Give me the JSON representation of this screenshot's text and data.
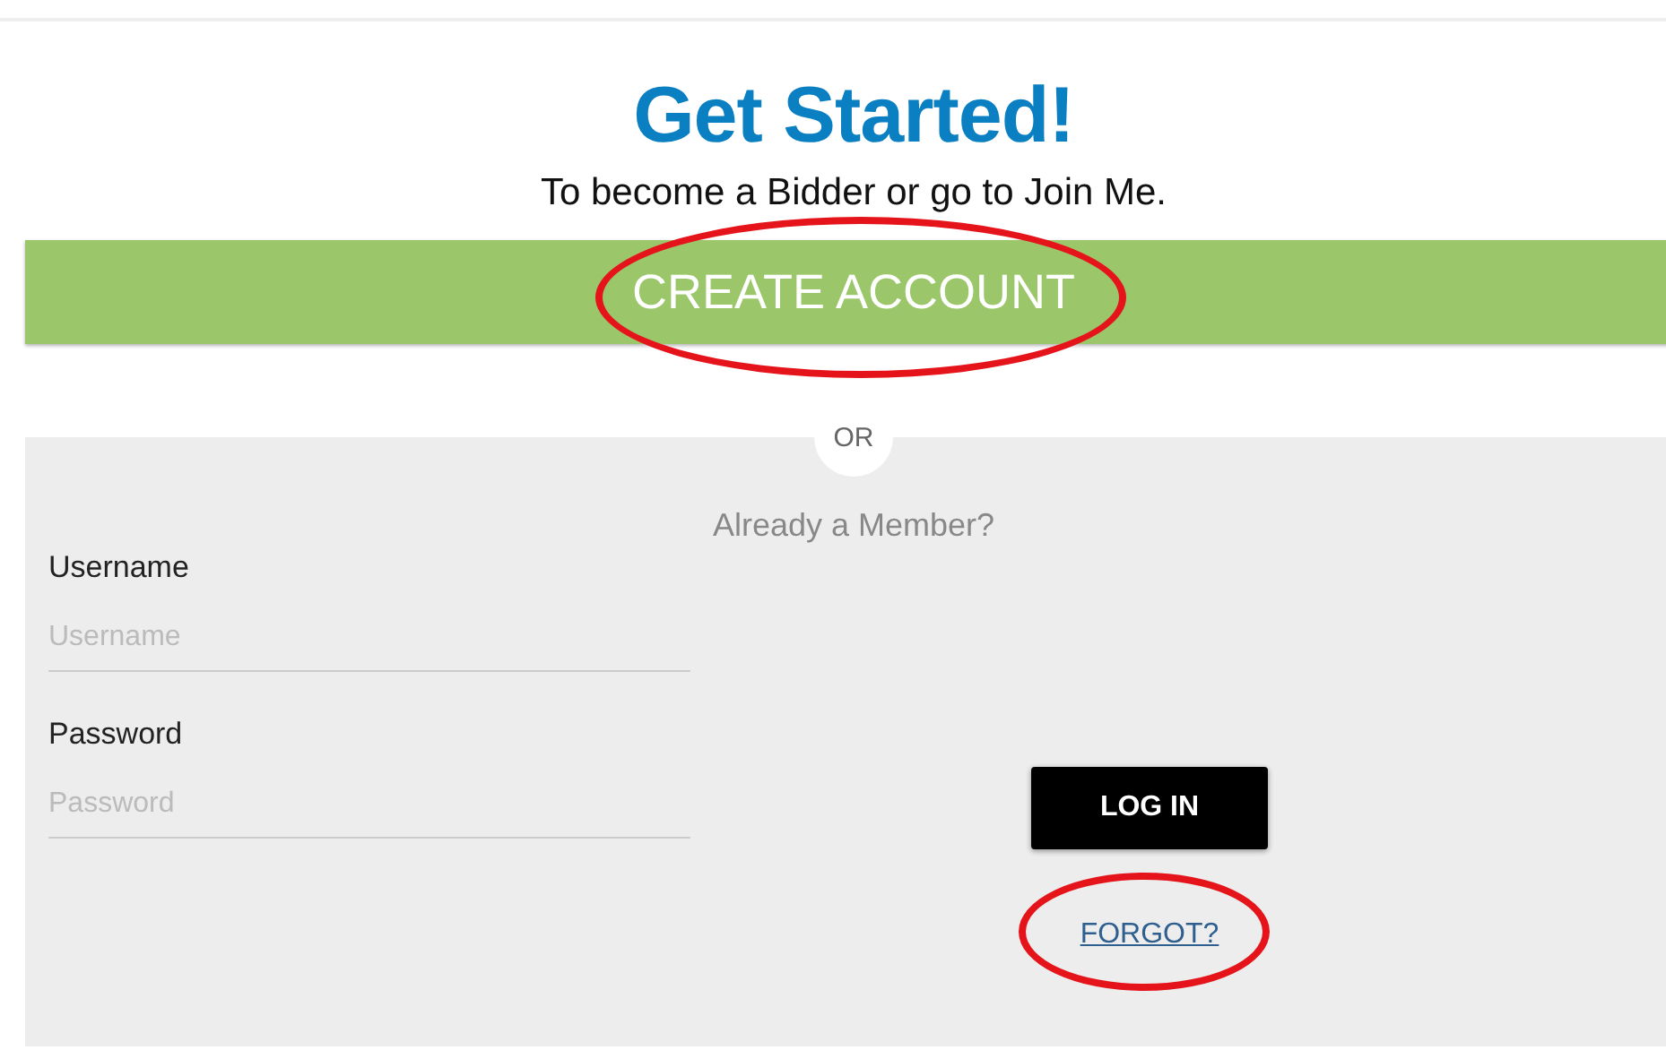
{
  "heading": "Get Started!",
  "subtitle": "To become a Bidder or go to Join Me.",
  "create_account": {
    "label": "CREATE ACCOUNT",
    "highlighted": true
  },
  "divider": "OR",
  "login": {
    "prompt": "Already a Member?",
    "fields": [
      {
        "label": "Username",
        "placeholder": "Username"
      },
      {
        "label": "Password",
        "placeholder": "Password"
      }
    ],
    "button": "LOG IN",
    "forgot_link": {
      "label": "FORGOT?",
      "highlighted": true
    }
  }
}
